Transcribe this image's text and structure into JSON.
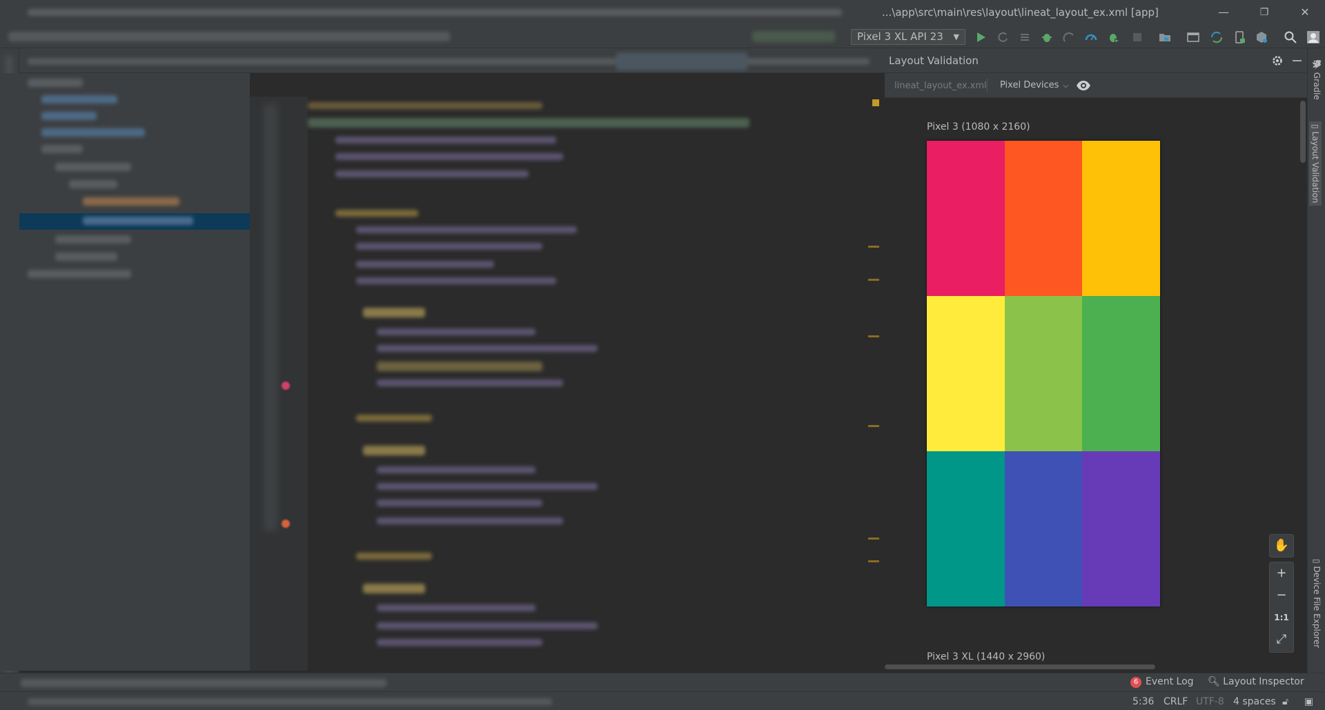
{
  "window": {
    "title": "...\\app\\src\\main\\res\\layout\\lineat_layout_ex.xml [app]",
    "minimize_glyph": "—",
    "restore_glyph": "❐",
    "close_glyph": "✕"
  },
  "toolbar": {
    "device_selector": "Pixel 3 XL API 23"
  },
  "layout_validation": {
    "title": "Layout Validation",
    "file_name": "lineat_layout_ex.xml",
    "device_filter": "Pixel Devices",
    "previews": [
      {
        "label": "Pixel 3 (1080 x 2160)",
        "cells": [
          "#e91e63",
          "#ff5722",
          "#ffc107",
          "#ffeb3b",
          "#8bc34a",
          "#4caf50",
          "#009688",
          "#3f51b5",
          "#673ab7"
        ]
      },
      {
        "label": "Pixel 3 XL (1440 x 2960)"
      }
    ],
    "zoom": {
      "pan": "✋",
      "zoom_in": "+",
      "zoom_out": "−",
      "actual_size": "1:1",
      "fit": "⤢"
    }
  },
  "right_stripe": {
    "tabs": [
      "Gradle",
      "Layout Validation",
      "Device File Explorer"
    ]
  },
  "bottom_bar": {
    "event_log_count": "6",
    "event_log": "Event Log",
    "layout_inspector": "Layout Inspector"
  },
  "status_bar": {
    "position": "5:36",
    "line_sep": "CRLF",
    "encoding": "UTF-8",
    "indent": "4 spaces"
  }
}
